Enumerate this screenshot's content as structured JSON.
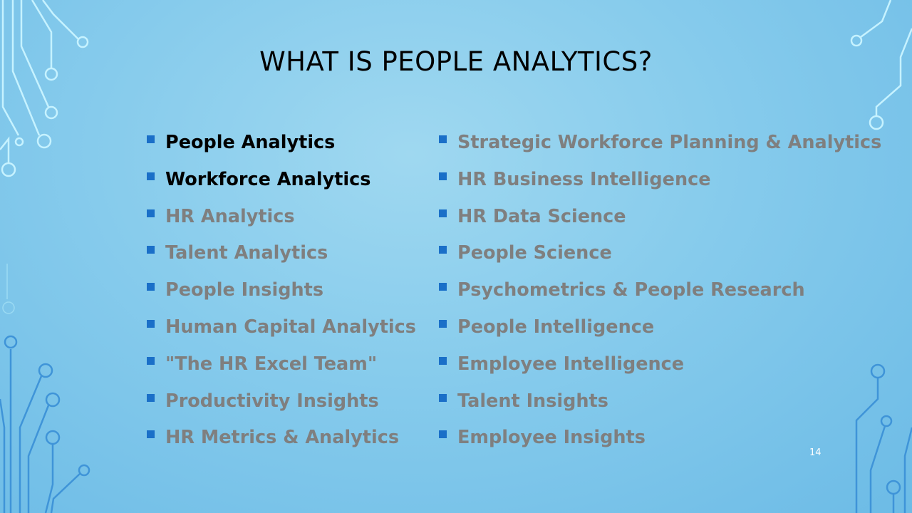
{
  "slide": {
    "title": "WHAT IS PEOPLE ANALYTICS?",
    "page_number": "14",
    "colors": {
      "bullet": "#1a6fc8",
      "active_text": "#000000",
      "inactive_text": "#7f7f7f",
      "circuit_light": "#c6f2ff",
      "circuit_dark": "#3f94d8"
    },
    "left_items": [
      {
        "label": "People Analytics",
        "active": true
      },
      {
        "label": "Workforce Analytics",
        "active": true
      },
      {
        "label": "HR Analytics",
        "active": false
      },
      {
        "label": "Talent Analytics",
        "active": false
      },
      {
        "label": "People Insights",
        "active": false
      },
      {
        "label": "Human Capital Analytics",
        "active": false
      },
      {
        "label": "\"The HR Excel Team\"",
        "active": false
      },
      {
        "label": "Productivity Insights",
        "active": false
      },
      {
        "label": "HR Metrics & Analytics",
        "active": false
      }
    ],
    "right_items": [
      {
        "label": "Strategic Workforce Planning & Analytics",
        "active": false
      },
      {
        "label": "HR Business Intelligence",
        "active": false
      },
      {
        "label": "HR Data Science",
        "active": false
      },
      {
        "label": "People Science",
        "active": false
      },
      {
        "label": "Psychometrics & People Research",
        "active": false
      },
      {
        "label": "People Intelligence",
        "active": false
      },
      {
        "label": "Employee Intelligence",
        "active": false
      },
      {
        "label": "Talent Insights",
        "active": false
      },
      {
        "label": "Employee Insights",
        "active": false
      }
    ]
  }
}
